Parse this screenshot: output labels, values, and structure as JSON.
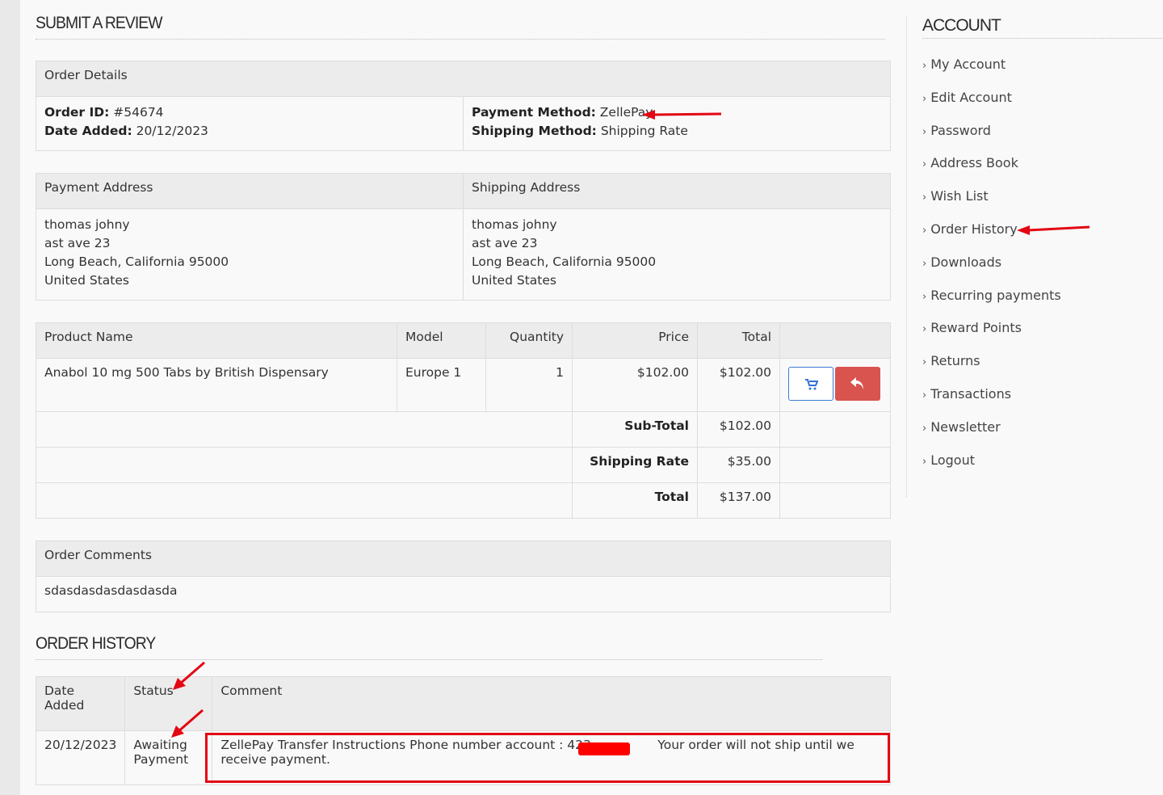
{
  "review": {
    "title": "SUBMIT A REVIEW",
    "order_details": {
      "header": "Order Details",
      "order_id_label": "Order ID:",
      "order_id": "#54674",
      "date_added_label": "Date Added:",
      "date_added": "20/12/2023",
      "payment_method_label": "Payment Method:",
      "payment_method": "ZellePay",
      "shipping_method_label": "Shipping Method:",
      "shipping_method": "Shipping Rate"
    },
    "addresses": {
      "payment_header": "Payment Address",
      "shipping_header": "Shipping Address",
      "payment_lines": [
        "thomas johny",
        "ast ave 23",
        "Long Beach, California 95000",
        "United States"
      ],
      "shipping_lines": [
        "thomas johny",
        "ast ave 23",
        "Long Beach, California 95000",
        "United States"
      ]
    },
    "products": {
      "headers": [
        "Product Name",
        "Model",
        "Quantity",
        "Price",
        "Total"
      ],
      "row": {
        "name": "Anabol 10 mg 500 Tabs by British Dispensary",
        "model": "Europe 1",
        "quantity": "1",
        "price": "$102.00",
        "total": "$102.00"
      },
      "totals": [
        {
          "label": "Sub-Total",
          "value": "$102.00"
        },
        {
          "label": "Shipping Rate",
          "value": "$35.00"
        },
        {
          "label": "Total",
          "value": "$137.00"
        }
      ]
    },
    "comments": {
      "header": "Order Comments",
      "text": "sdasdasdasdasdasda"
    }
  },
  "history": {
    "title": "ORDER HISTORY",
    "headers": [
      "Date Added",
      "Status",
      "Comment"
    ],
    "row": {
      "date": "20/12/2023",
      "status": "Awaiting Payment",
      "comment": "ZellePay Transfer Instructions Phone number account : 423      Your order will not ship until we receive payment."
    }
  },
  "sidebar": {
    "title": "ACCOUNT",
    "items": [
      "My Account",
      "Edit Account",
      "Password",
      "Address Book",
      "Wish List",
      "Order History",
      "Downloads",
      "Recurring payments",
      "Reward Points",
      "Returns",
      "Transactions",
      "Newsletter",
      "Logout"
    ]
  },
  "icons": {
    "cart": "shopping-cart-icon",
    "reorder": "reply-icon"
  },
  "colors": {
    "annotation": "#e30613",
    "cart_button_border": "#3a7bd5",
    "return_button": "#d9534f"
  }
}
